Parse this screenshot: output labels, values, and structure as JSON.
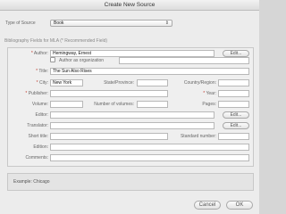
{
  "window": {
    "title": "Create New Source"
  },
  "type_of_source": {
    "label": "Type of Source",
    "value": "Book"
  },
  "fields_header": "Bibliography Fields for MLA  (* Recommended Field)",
  "labels": {
    "author": "Author:",
    "corporate": "Author as organization",
    "title": "Title:",
    "city": "City:",
    "state": "State/Province:",
    "country": "Country/Region:",
    "publisher": "Publisher:",
    "year": "Year:",
    "volume": "Volume:",
    "num_volumes": "Number of volumes:",
    "pages": "Pages:",
    "editor": "Editor:",
    "translator": "Translator:",
    "short_title": "Short title:",
    "standard_number": "Standard number:",
    "edition": "Edition:",
    "comments": "Comments:"
  },
  "values": {
    "author": "Hemingway, Ernest",
    "title": "The Sun Also Rises",
    "city": "New York"
  },
  "buttons": {
    "edit": "Edit...",
    "cancel": "Cancel",
    "ok": "OK"
  },
  "example": "Example: Chicago"
}
